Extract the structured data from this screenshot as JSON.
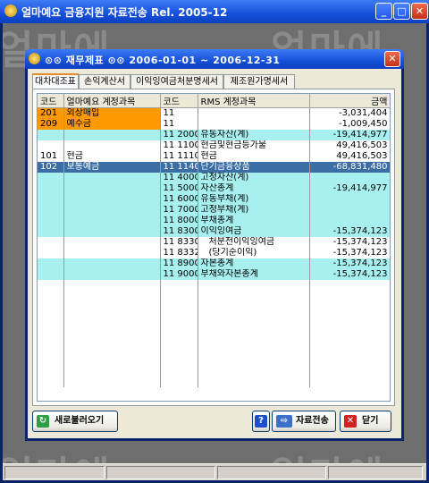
{
  "app": {
    "title": "얼마예요 금융지원 자료전송 Rel. 2005-12"
  },
  "watermark": "얼마에",
  "dialog": {
    "title": "⊙⊙ 재무제표 ⊙⊙ 2006-01-01 ~ 2006-12-31",
    "tabs": [
      "대차대조표",
      "손익계산서",
      "이익잉여금처분명세서",
      "제조원가명세서"
    ],
    "active_tab": 0
  },
  "table": {
    "headers": [
      "코드",
      "얼마예요 계정과목",
      "코드",
      "RMS 계정과목",
      "금액"
    ],
    "rows": [
      {
        "c1": "201",
        "c2": "외상매입",
        "c3": "11",
        "c4": "",
        "c5": "-3,031,404",
        "style": "white",
        "orange": true
      },
      {
        "c1": "209",
        "c2": "예수금",
        "c3": "11",
        "c4": "",
        "c5": "-1,009,450",
        "style": "white",
        "orange": true
      },
      {
        "c1": "",
        "c2": "",
        "c3": "11 2000",
        "c4": "유동자산(계)",
        "c5": "-19,414,977",
        "style": "cyan"
      },
      {
        "c1": "",
        "c2": "",
        "c3": "11 1100",
        "c4": "현금및현금등가물",
        "c5": "49,416,503",
        "style": "white"
      },
      {
        "c1": "101",
        "c2": "현금",
        "c3": "11 1110",
        "c4": "현금",
        "c5": "49,416,503",
        "style": "white"
      },
      {
        "c1": "102",
        "c2": "보통예금",
        "c3": "11 1140",
        "c4": "단기금융상품",
        "c5": "-68,831,480",
        "style": "sel"
      },
      {
        "c1": "",
        "c2": "",
        "c3": "11 4000",
        "c4": "고정자산(계)",
        "c5": "",
        "style": "cyan"
      },
      {
        "c1": "",
        "c2": "",
        "c3": "11 5000",
        "c4": "자산총계",
        "c5": "-19,414,977",
        "style": "cyan"
      },
      {
        "c1": "",
        "c2": "",
        "c3": "11 6000",
        "c4": "유동부채(계)",
        "c5": "",
        "style": "cyan"
      },
      {
        "c1": "",
        "c2": "",
        "c3": "11 7000",
        "c4": "고정부채(계)",
        "c5": "",
        "style": "cyan"
      },
      {
        "c1": "",
        "c2": "",
        "c3": "11 8000",
        "c4": "부채총계",
        "c5": "",
        "style": "cyan"
      },
      {
        "c1": "",
        "c2": "",
        "c3": "11 8300",
        "c4": "이익잉여금",
        "c5": "-15,374,123",
        "style": "cyan"
      },
      {
        "c1": "",
        "c2": "",
        "c3": "11 8330",
        "c4": "처분전이익잉여금",
        "c5": "-15,374,123",
        "style": "white",
        "indent": true
      },
      {
        "c1": "",
        "c2": "",
        "c3": "11 8332",
        "c4": "(당기순이익)",
        "c5": "-15,374,123",
        "style": "white",
        "indent": true
      },
      {
        "c1": "",
        "c2": "",
        "c3": "11 8900",
        "c4": "자본총계",
        "c5": "-15,374,123",
        "style": "cyan"
      },
      {
        "c1": "",
        "c2": "",
        "c3": "11 9000",
        "c4": "부채와자본총계",
        "c5": "-15,374,123",
        "style": "cyan"
      }
    ]
  },
  "buttons": {
    "refresh": "새로불러오기",
    "help": "?",
    "send": "자료전송",
    "close": "닫기"
  },
  "colors": {
    "orange": "#ff9900",
    "cyan": "#a8f0f0",
    "selected": "#3a6ea5"
  }
}
